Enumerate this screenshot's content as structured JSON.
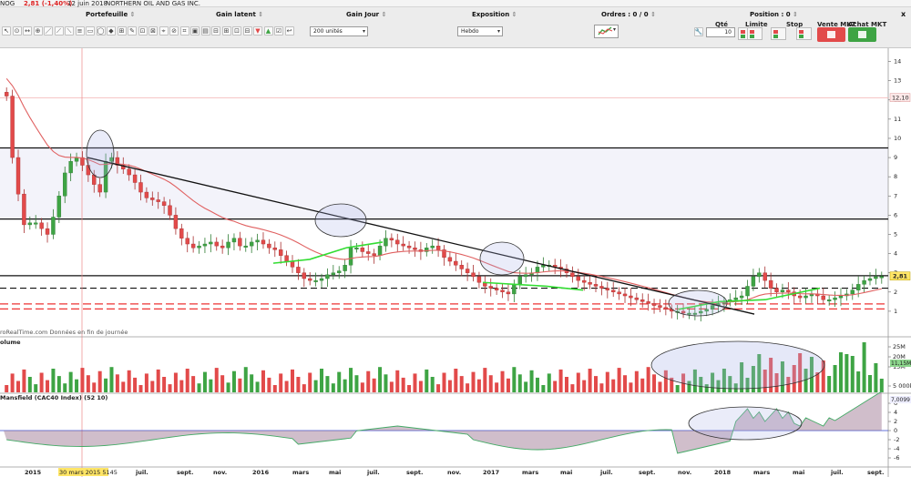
{
  "titlebar": {
    "symbol": "NOG",
    "quote": "2,81 (-1,40%)",
    "date": "12 juin 2018",
    "name": "NORTHERN OIL AND GAS INC."
  },
  "header": {
    "portefeuille": "Portefeuille",
    "gain_latent": "Gain latent",
    "gain_jour": "Gain Jour",
    "exposition": "Exposition",
    "ordres_label": "Ordres :",
    "ordres_value": "0 / 0",
    "position_label": "Position :",
    "position_value": "0",
    "close_glyph": "x"
  },
  "toolbar": {
    "units": "200 unités",
    "period": "Hebdo",
    "qty_label": "Qté",
    "qty_value": "10",
    "limite_label": "Limite",
    "stop_label": "Stop",
    "vente_label": "Vente MKT",
    "achat_label": "Achat MKT"
  },
  "colors": {
    "up": "#3ea444",
    "down": "#e24a4a",
    "ma": "#e06060",
    "green_line": "#33dd33",
    "oval": "#aab4e8"
  },
  "chart_data": [
    {
      "type": "candlestick",
      "title": "",
      "x_axis_labels": [
        "2015",
        "juil.",
        "sept.",
        "nov.",
        "2016",
        "mars",
        "mai",
        "juil.",
        "sept.",
        "nov.",
        "2017",
        "mars",
        "mai",
        "juil.",
        "sept.",
        "nov.",
        "2018",
        "mars",
        "mai",
        "juil.",
        "sept."
      ],
      "cursor_label": "30 mars 2015 5145",
      "y_axis": {
        "ticks": [
          "14",
          "13",
          "12",
          "11",
          "10",
          "9",
          "8",
          "7",
          "6",
          "5",
          "4",
          "3",
          "2",
          "1"
        ]
      },
      "last_price_label": "2,81",
      "reference_price_label": "12,10",
      "watermark": "roRealTime.com  Données en fin de journée",
      "horizontal_lines": [
        "9.5",
        "5.8",
        "2.85"
      ],
      "close_series": [
        12.2,
        9.0,
        7.1,
        5.5,
        5.6,
        5.6,
        5.3,
        5.0,
        5.9,
        7.0,
        8.2,
        8.8,
        9.0,
        8.6,
        8.1,
        7.6,
        7.2,
        8.8,
        9.0,
        8.6,
        8.4,
        8.1,
        7.7,
        7.2,
        6.9,
        6.8,
        6.7,
        6.5,
        6.0,
        5.3,
        4.8,
        4.5,
        4.3,
        4.4,
        4.5,
        4.6,
        4.4,
        4.3,
        4.6,
        4.8,
        4.4,
        4.4,
        4.6,
        4.7,
        4.5,
        4.3,
        4.2,
        3.9,
        3.6,
        3.3,
        3.0,
        2.7,
        2.6,
        2.6,
        2.7,
        2.9,
        3.0,
        3.1,
        3.4,
        4.3,
        4.3,
        4.1,
        4.0,
        3.9,
        4.4,
        4.8,
        4.7,
        4.5,
        4.4,
        4.3,
        4.2,
        4.1,
        4.3,
        4.4,
        4.2,
        3.8,
        3.6,
        3.4,
        3.2,
        3.0,
        2.8,
        2.5,
        2.3,
        2.2,
        2.1,
        2.0,
        1.9,
        2.4,
        2.8,
        2.9,
        3.0,
        3.3,
        3.4,
        3.4,
        3.3,
        3.2,
        3.0,
        2.8,
        2.6,
        2.5,
        2.4,
        2.3,
        2.2,
        2.1,
        2.0,
        1.9,
        1.8,
        1.7,
        1.6,
        1.5,
        1.4,
        1.3,
        1.2,
        1.1,
        1.0,
        1.0,
        0.9,
        0.9,
        0.9,
        1.0,
        1.1,
        1.3,
        1.4,
        1.5,
        1.6,
        1.7,
        1.8,
        2.3,
        2.8,
        3.0,
        2.6,
        2.2,
        2.0,
        2.1,
        2.0,
        1.8,
        1.7,
        1.8,
        1.9,
        1.8,
        1.6,
        1.6,
        1.7,
        1.8,
        1.9,
        2.1,
        2.4,
        2.6,
        2.7,
        2.8,
        2.81
      ],
      "moving_average": "declining",
      "annotations": [
        "ovals",
        "trendline"
      ]
    },
    {
      "type": "bar",
      "title": "olume",
      "y_axis": {
        "ticks": [
          "25M",
          "20M",
          "15M",
          "5 000k"
        ]
      },
      "last_value_label": "11,15M"
    },
    {
      "type": "area",
      "title": "Mansfield (CAC40 Index) (52 10)",
      "y_axis": {
        "ticks": [
          "6",
          "4",
          "2",
          "0",
          "-2",
          "-4",
          "-6"
        ]
      },
      "last_value_label": "7,0099"
    }
  ]
}
